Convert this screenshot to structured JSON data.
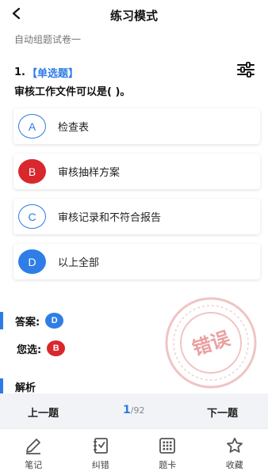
{
  "header": {
    "title": "练习模式"
  },
  "paper": {
    "name": "自动组题试卷一"
  },
  "question": {
    "number": "1.",
    "type": "【单选题】",
    "text": "审核工作文件可以是( )。",
    "options": [
      {
        "letter": "A",
        "text": "检查表",
        "state": "normal"
      },
      {
        "letter": "B",
        "text": "审核抽样方案",
        "state": "wrong"
      },
      {
        "letter": "C",
        "text": "审核记录和不符合报告",
        "state": "normal"
      },
      {
        "letter": "D",
        "text": "以上全部",
        "state": "correct"
      }
    ]
  },
  "answer": {
    "label": "答案:",
    "value": "D"
  },
  "selected": {
    "label": "您选:",
    "value": "B"
  },
  "stamp": {
    "text": "错误"
  },
  "analysis": {
    "label": "解析"
  },
  "pager": {
    "prev": "上一题",
    "current": "1",
    "total": "/92",
    "next": "下一题"
  },
  "tabbar": [
    {
      "label": "笔记",
      "icon": "pencil-icon"
    },
    {
      "label": "纠错",
      "icon": "correction-icon"
    },
    {
      "label": "题卡",
      "icon": "answer-card-icon"
    },
    {
      "label": "收藏",
      "icon": "star-icon"
    }
  ],
  "colors": {
    "accent": "#2d7be5",
    "wrong": "#d8282d",
    "stamp": "#e9a0a0"
  }
}
